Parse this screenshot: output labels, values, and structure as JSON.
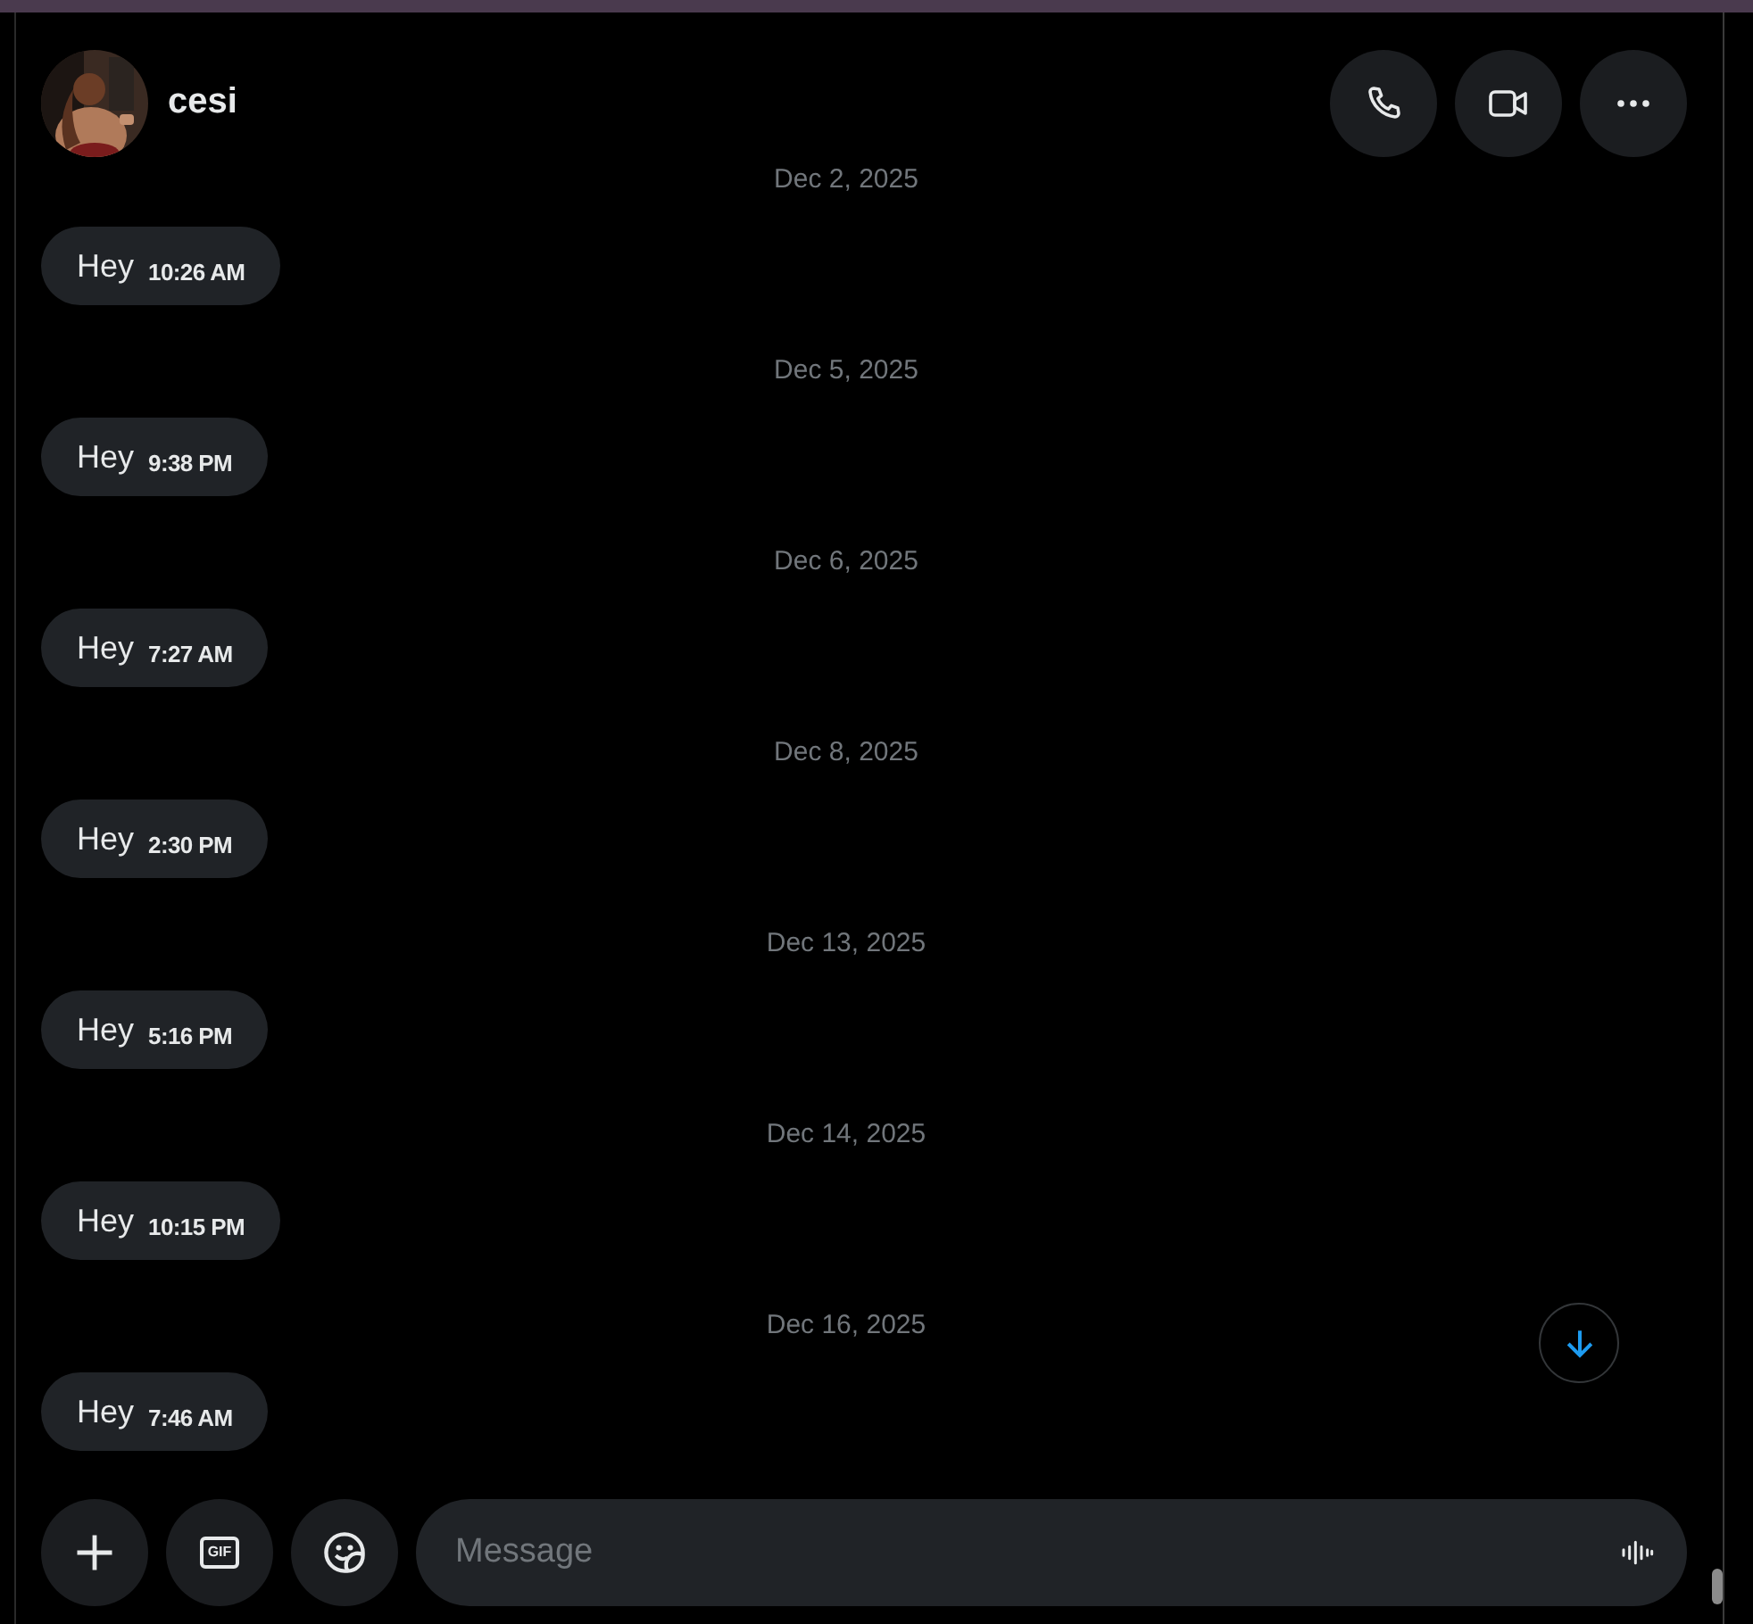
{
  "header": {
    "name": "cesi",
    "actions": [
      {
        "kind": "call"
      },
      {
        "kind": "video"
      },
      {
        "kind": "more"
      }
    ]
  },
  "conversation": [
    {
      "date": "Dec 2, 2025",
      "messages": [
        {
          "text": "Hey",
          "time": "10:26 AM"
        }
      ]
    },
    {
      "date": "Dec 5, 2025",
      "messages": [
        {
          "text": "Hey",
          "time": "9:38 PM"
        }
      ]
    },
    {
      "date": "Dec 6, 2025",
      "messages": [
        {
          "text": "Hey",
          "time": "7:27 AM"
        }
      ]
    },
    {
      "date": "Dec 8, 2025",
      "messages": [
        {
          "text": "Hey",
          "time": "2:30 PM"
        }
      ]
    },
    {
      "date": "Dec 13, 2025",
      "messages": [
        {
          "text": "Hey",
          "time": "5:16 PM"
        }
      ]
    },
    {
      "date": "Dec 14, 2025",
      "messages": [
        {
          "text": "Hey",
          "time": "10:15 PM"
        }
      ]
    },
    {
      "date": "Dec 16, 2025",
      "messages": [
        {
          "text": "Hey",
          "time": "7:46 AM"
        }
      ]
    }
  ],
  "composer": {
    "buttons": [
      {
        "kind": "add"
      },
      {
        "kind": "gif",
        "label": "GIF"
      },
      {
        "kind": "emoji"
      }
    ],
    "placeholder": "Message"
  }
}
